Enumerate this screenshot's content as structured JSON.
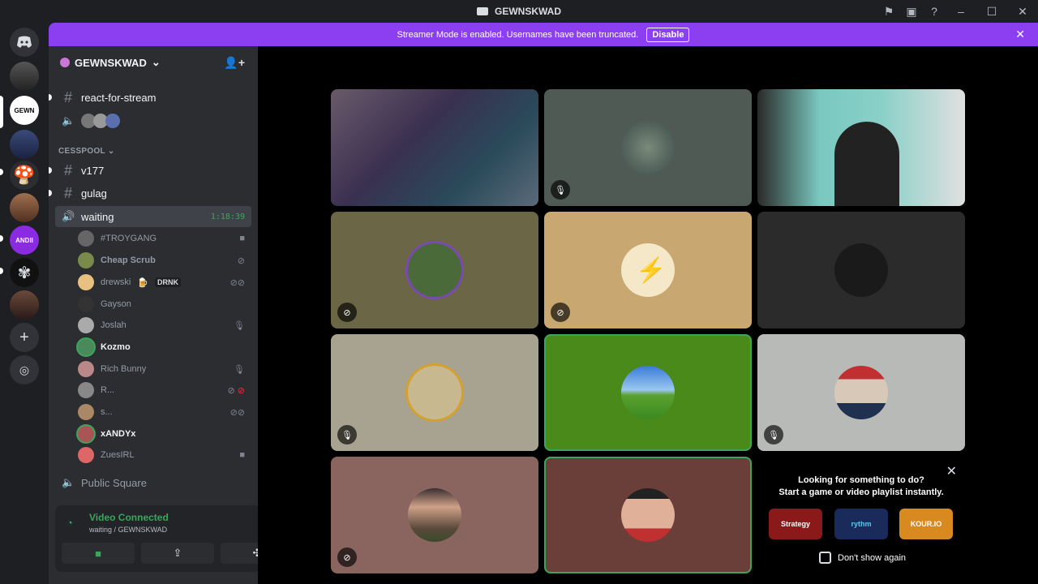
{
  "titlebar": {
    "title": "GEWNSKWAD"
  },
  "banner": {
    "text": "Streamer Mode is enabled. Usernames have been truncated.",
    "button": "Disable"
  },
  "server": {
    "name": "GEWNSKWAD"
  },
  "sidebar": {
    "channel_react": "react-for-stream",
    "category_cesspool": "CESSPOOL",
    "channel_v177": "v177",
    "channel_gulag": "gulag",
    "channel_waiting": "waiting",
    "waiting_timer": "1:18:39",
    "voice_users": [
      {
        "name": "#TROYGANG"
      },
      {
        "name": "Cheap Scrub"
      },
      {
        "name": "drewski",
        "tag": "DRNK"
      },
      {
        "name": "Gayson"
      },
      {
        "name": "Joslah"
      },
      {
        "name": "Kozmo"
      },
      {
        "name": "Rich Bunny"
      },
      {
        "name": "R..."
      },
      {
        "name": "s..."
      },
      {
        "name": "xANDYx"
      },
      {
        "name": "ZuesIRL"
      }
    ],
    "channel_public": "Public Square"
  },
  "voice_panel": {
    "status": "Video Connected",
    "location": "waiting / GEWNSKWAD"
  },
  "promo": {
    "line1": "Looking for something to do?",
    "line2": "Start a game or video playlist instantly.",
    "apps": [
      "Strategy",
      "rythm",
      "KOUR.IO"
    ],
    "dont_show": "Don't show again"
  },
  "colors": {
    "accent": "#8c3ff0",
    "speaking": "#3ba55d",
    "brand": "#5865f2"
  }
}
